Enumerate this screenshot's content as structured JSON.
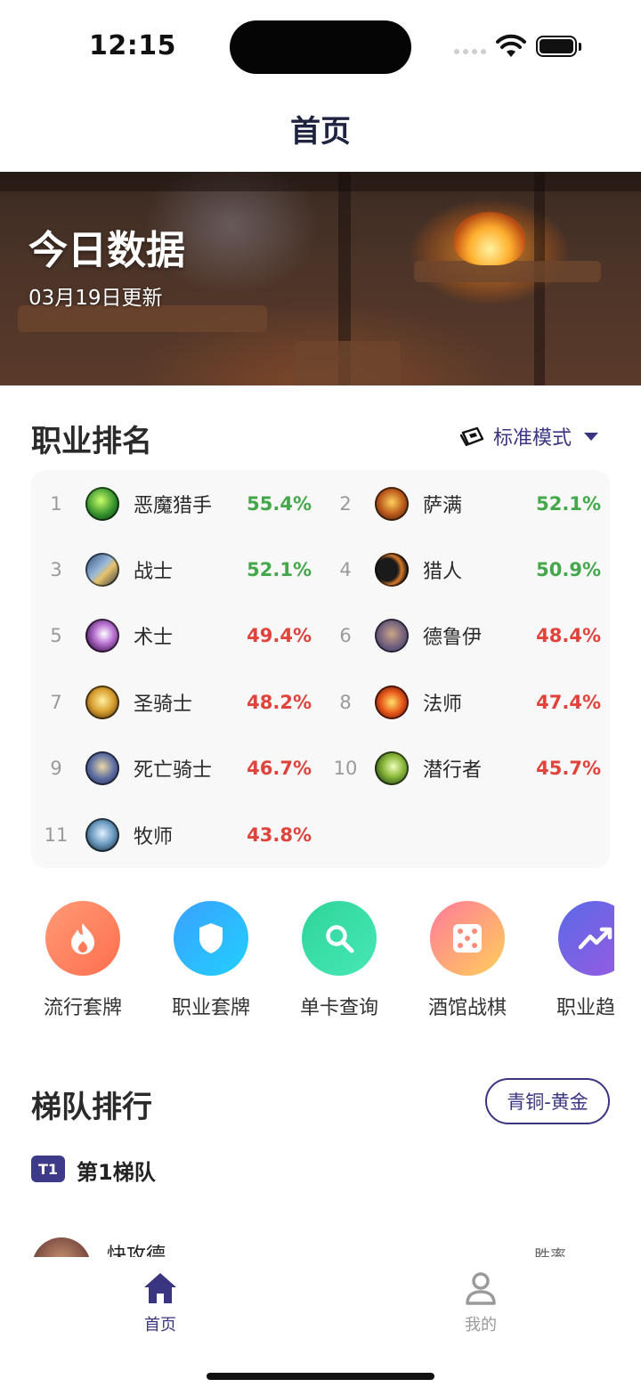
{
  "status": {
    "time": "12:15"
  },
  "nav": {
    "title": "首页"
  },
  "banner": {
    "title": "今日数据",
    "subtitle": "03月19日更新"
  },
  "class_ranking": {
    "title": "职业排名",
    "mode_label": "标准模式",
    "items": [
      {
        "rank": "1",
        "name": "恶魔猎手",
        "rate": "55.4%",
        "trend": "up",
        "icon": "demon-hunter-icon"
      },
      {
        "rank": "2",
        "name": "萨满",
        "rate": "52.1%",
        "trend": "up",
        "icon": "shaman-icon"
      },
      {
        "rank": "3",
        "name": "战士",
        "rate": "52.1%",
        "trend": "up",
        "icon": "warrior-icon"
      },
      {
        "rank": "4",
        "name": "猎人",
        "rate": "50.9%",
        "trend": "up",
        "icon": "hunter-icon"
      },
      {
        "rank": "5",
        "name": "术士",
        "rate": "49.4%",
        "trend": "down",
        "icon": "warlock-icon"
      },
      {
        "rank": "6",
        "name": "德鲁伊",
        "rate": "48.4%",
        "trend": "down",
        "icon": "druid-icon"
      },
      {
        "rank": "7",
        "name": "圣骑士",
        "rate": "48.2%",
        "trend": "down",
        "icon": "paladin-icon"
      },
      {
        "rank": "8",
        "name": "法师",
        "rate": "47.4%",
        "trend": "down",
        "icon": "mage-icon"
      },
      {
        "rank": "9",
        "name": "死亡骑士",
        "rate": "46.7%",
        "trend": "down",
        "icon": "death-knight-icon"
      },
      {
        "rank": "10",
        "name": "潜行者",
        "rate": "45.7%",
        "trend": "down",
        "icon": "rogue-icon"
      },
      {
        "rank": "11",
        "name": "牧师",
        "rate": "43.8%",
        "trend": "down",
        "icon": "priest-icon"
      }
    ]
  },
  "quick_entries": [
    {
      "label": "流行套牌",
      "icon": "flame-icon"
    },
    {
      "label": "职业套牌",
      "icon": "shield-icon"
    },
    {
      "label": "单卡查询",
      "icon": "search-icon"
    },
    {
      "label": "酒馆战棋",
      "icon": "dice-icon"
    },
    {
      "label": "职业趋势",
      "icon": "trend-icon"
    }
  ],
  "ladder": {
    "title": "梯队排行",
    "filter": "青铜-黄金",
    "tier_badge": "T1",
    "tier_title": "第1梯队",
    "first_deck": {
      "name": "快攻德",
      "rate_label": "胜率"
    }
  },
  "tabs": [
    {
      "label": "首页",
      "icon": "home-icon",
      "active": true
    },
    {
      "label": "我的",
      "icon": "user-icon",
      "active": false
    }
  ],
  "colors": {
    "accent": "#3a3580",
    "rate_up": "#43a84a",
    "rate_down": "#e0433c",
    "tab_inactive": "#9a9a9a"
  }
}
